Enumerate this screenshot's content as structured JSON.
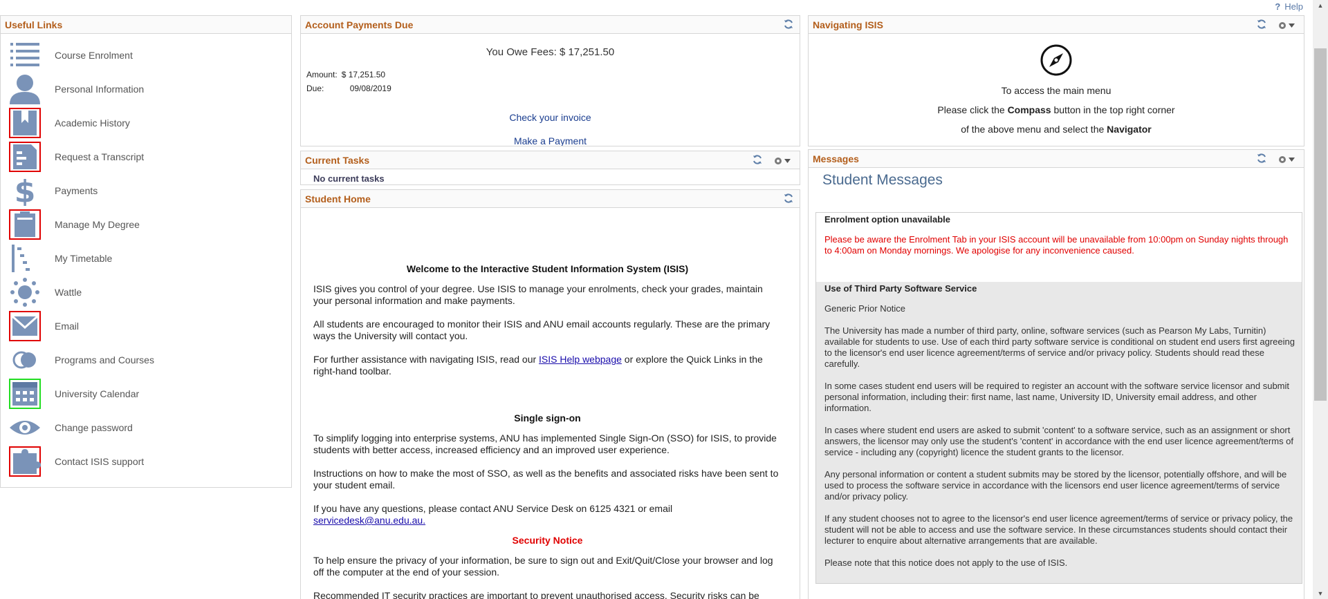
{
  "help": {
    "label": "Help"
  },
  "useful_links": {
    "title": "Useful Links",
    "items": [
      {
        "label": "Course Enrolment",
        "icon": "list-icon"
      },
      {
        "label": "Personal Information",
        "icon": "person-icon"
      },
      {
        "label": "Academic History",
        "icon": "bookmark-book-icon"
      },
      {
        "label": "Request a Transcript",
        "icon": "transcript-icon"
      },
      {
        "label": "Payments",
        "icon": "dollar-icon"
      },
      {
        "label": "Manage My Degree",
        "icon": "clipboard-icon"
      },
      {
        "label": "My Timetable",
        "icon": "timetable-icon"
      },
      {
        "label": "Wattle",
        "icon": "sun-icon"
      },
      {
        "label": "Email",
        "icon": "envelope-icon"
      },
      {
        "label": "Programs and Courses",
        "icon": "toggle-icon"
      },
      {
        "label": "University Calendar",
        "icon": "calendar-icon"
      },
      {
        "label": "Change password",
        "icon": "eye-icon"
      },
      {
        "label": "Contact ISIS support",
        "icon": "puzzle-icon"
      }
    ]
  },
  "account_payments": {
    "title": "Account Payments Due",
    "owe_line": "You Owe Fees: $ 17,251.50",
    "amount_label": "Amount:",
    "amount_value": "$ 17,251.50",
    "due_label": "Due:",
    "due_value": "09/08/2019",
    "check_invoice": "Check your invoice",
    "make_payment": "Make a Payment"
  },
  "current_tasks": {
    "title": "Current Tasks",
    "empty": "No current tasks"
  },
  "student_home": {
    "title": "Student Home",
    "welcome": "Welcome to the Interactive Student Information System (ISIS)",
    "p1": "ISIS gives you control of your degree. Use ISIS to manage your enrolments, check your grades, maintain your personal information and make payments.",
    "p2": "All students are encouraged to monitor their ISIS and ANU email accounts regularly. These are the primary ways the University will contact you.",
    "p3_a": "For further assistance with navigating ISIS, read our ",
    "p3_link": "ISIS Help webpage",
    "p3_b": " or explore the Quick Links in the right-hand toolbar.",
    "sso_heading": "Single sign-on",
    "p4": "To simplify logging into enterprise systems, ANU has implemented Single Sign-On (SSO) for ISIS, to provide students with better access, increased efficiency and an improved user experience.",
    "p5": "Instructions on how to make the most of SSO, as well as the benefits and associated risks have been sent to your student email.",
    "p6_a": "If you have any questions, please contact ANU Service Desk on 6125 4321 or email ",
    "p6_link": "servicedesk@anu.edu.au.",
    "security_heading": "Security Notice",
    "p7": "To help ensure the privacy of your information, be sure to sign out and Exit/Quit/Close your browser and log off the computer at the end of your session.",
    "p8": "Recommended IT security practices are important to prevent unauthorised access. Security risks can be mitigated by:"
  },
  "navigating": {
    "title": "Navigating ISIS",
    "line1": "To access the main menu",
    "line2_a": "Please click the ",
    "line2_b": "Compass",
    "line2_c": " button in the top right corner",
    "line3_a": "of the above menu and select the ",
    "line3_b": "Navigator"
  },
  "messages": {
    "title": "Messages",
    "heading": "Student Messages",
    "msg1_title": "Enrolment option unavailable",
    "msg1_body": "Please be aware the Enrolment Tab in your ISIS account will be unavailable from 10:00pm on Sunday nights through to 4:00am on Monday mornings. We apologise for any inconvenience caused.",
    "msg2_title": "Use of Third Party Software Service",
    "msg2_p1": "Generic Prior Notice",
    "msg2_p2": "The University has made a number of third party, online, software services (such as Pearson My Labs, Turnitin) available for students to use. Use of each third party software service is conditional on student end users first agreeing to the licensor's end user licence agreement/terms of service and/or privacy policy. Students should read these carefully.",
    "msg2_p3": "In some cases student end users will be required to register an account with the software service licensor and submit personal information, including their: first name, last name, University ID, University email address, and other information.",
    "msg2_p4": "In cases where student end users are asked to submit 'content' to a software service, such as an assignment or short answers, the licensor may only use the student's 'content' in accordance with the end user licence agreement/terms of service - including any (copyright) licence the student grants to the licensor.",
    "msg2_p5": "Any personal information or content a student submits may be stored by the licensor, potentially offshore, and will be used to process the software service in accordance with the licensors end user licence agreement/terms of service and/or privacy policy.",
    "msg2_p6": "If any student chooses not to agree to the licensor's end user licence agreement/terms of service or privacy policy, the student will not be able to access and use the software service. In these circumstances students should contact their lecturer to enquire about alternative arrangements that are available.",
    "msg2_p7": "Please note that this notice does not apply to the use of ISIS."
  },
  "colors": {
    "title": "#b35e1b",
    "icon": "#7a93b8",
    "link": "#1a3d8f",
    "alert": "#e00000"
  }
}
